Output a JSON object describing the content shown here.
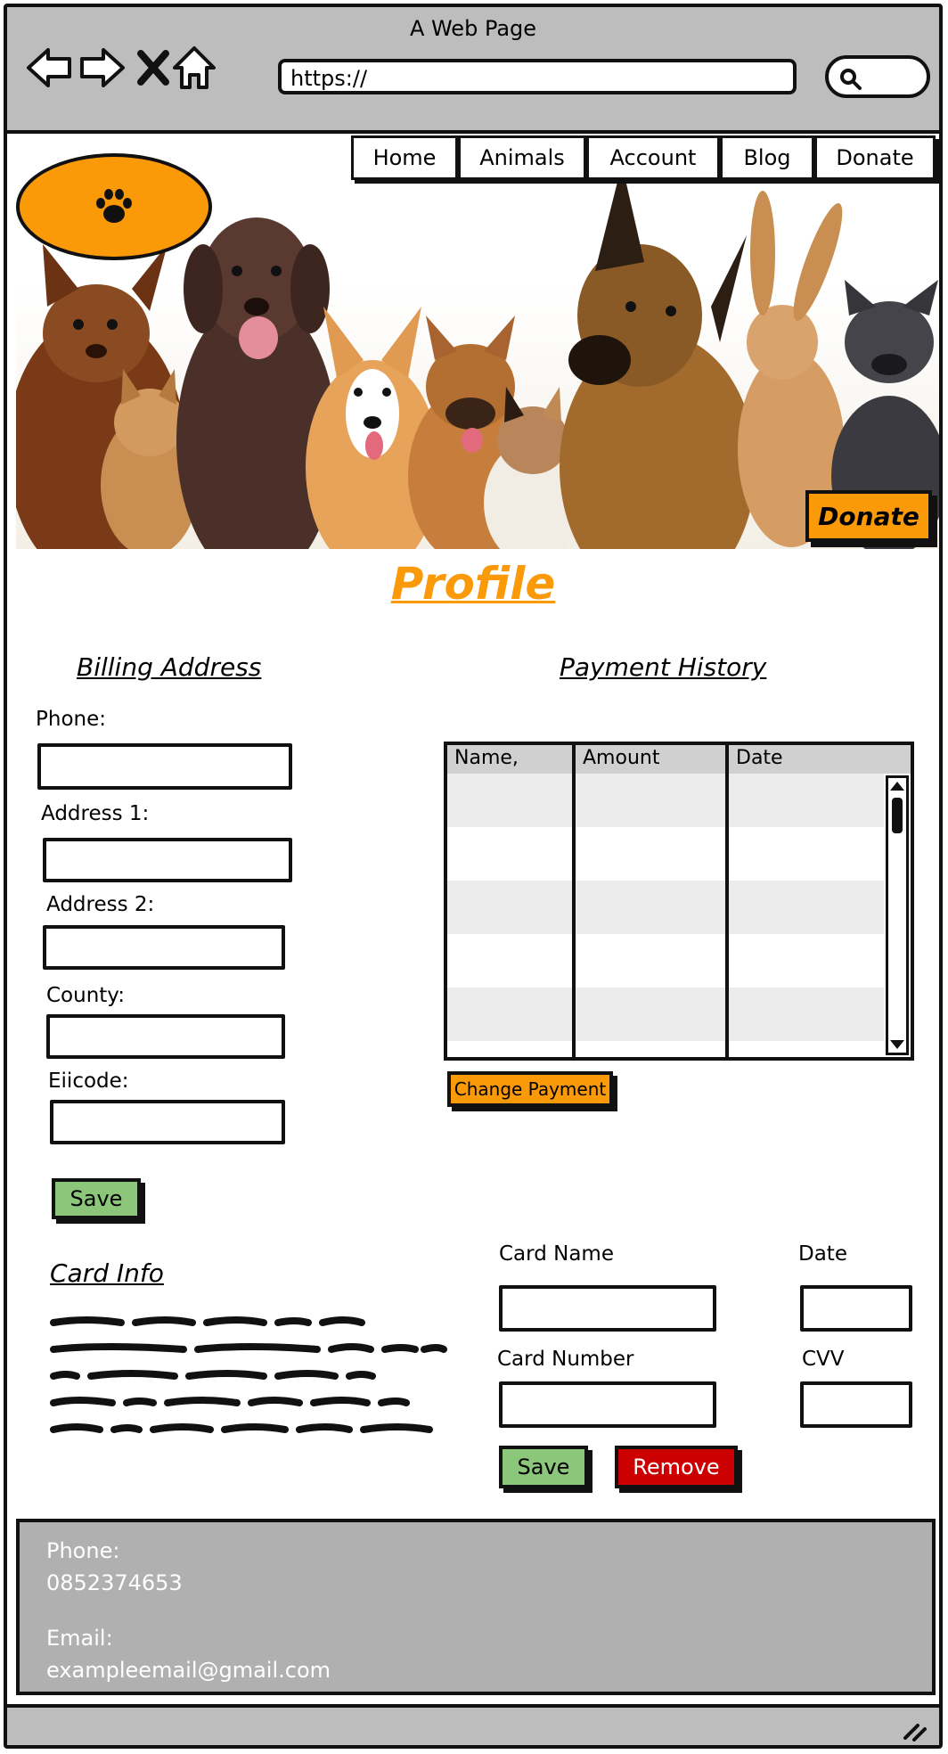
{
  "browser": {
    "title": "A Web Page",
    "url": "https://"
  },
  "nav": {
    "items": [
      "Home",
      "Animals",
      "Account",
      "Blog",
      "Donate"
    ]
  },
  "hero": {
    "donate_label": "Donate"
  },
  "page": {
    "title": "Profile"
  },
  "billing": {
    "heading": "Billing Address",
    "phone_label": "Phone:",
    "address1_label": "Address 1:",
    "address2_label": "Address 2:",
    "county_label": "County:",
    "eircode_label": "Eiicode:",
    "save_label": "Save"
  },
  "payment_history": {
    "heading": "Payment History",
    "columns": [
      "Name,",
      "Amount",
      "Date"
    ],
    "change_payment_label": "Change Payment"
  },
  "card": {
    "heading": "Card Info",
    "card_name_label": "Card Name",
    "date_label": "Date",
    "card_number_label": "Card Number",
    "cvv_label": "CVV",
    "save_label": "Save",
    "remove_label": "Remove"
  },
  "footer": {
    "phone_label": "Phone:",
    "phone_value": "0852374653",
    "email_label": "Email:",
    "email_value": "exampleemail@gmail.com"
  },
  "colors": {
    "accent": "#fb9a08",
    "save_green": "#8cc67a",
    "remove_red": "#cc0000",
    "chrome_gray": "#bdbdbd",
    "footer_gray": "#b0b0b0"
  },
  "icons": [
    "back-arrow-icon",
    "forward-arrow-icon",
    "close-icon",
    "home-icon",
    "search-icon",
    "paw-icon",
    "resize-grip-icon"
  ]
}
